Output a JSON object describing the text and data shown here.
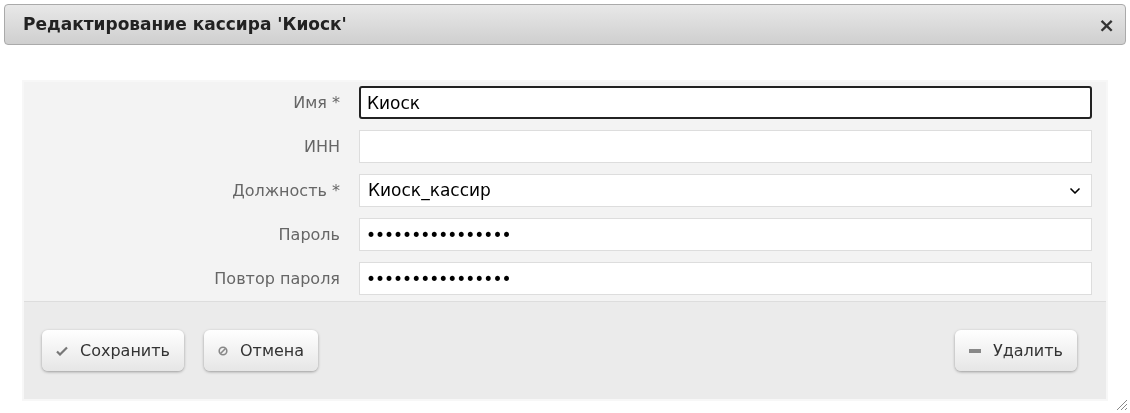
{
  "dialog": {
    "title": "Редактирование кассира 'Киоск'",
    "close": "×"
  },
  "fields": [
    {
      "label": "Имя *",
      "kind": "text",
      "value": "Киоск",
      "focused": true
    },
    {
      "label": "ИНН",
      "kind": "text",
      "focused": false
    },
    {
      "label": "Должность *",
      "kind": "select",
      "value": "Киоск_кассир",
      "focused": false
    },
    {
      "label": "Пароль",
      "kind": "password",
      "value": "••••••••••••••••",
      "focused": false
    },
    {
      "label": "Повтор пароля",
      "kind": "password",
      "value": "••••••••••••••••",
      "focused": false
    }
  ],
  "buttons": [
    {
      "label": "Сохранить",
      "kind": "save"
    },
    {
      "label": "Отмена",
      "kind": "cancel"
    },
    {
      "label": "Удалить",
      "kind": "delete"
    }
  ]
}
